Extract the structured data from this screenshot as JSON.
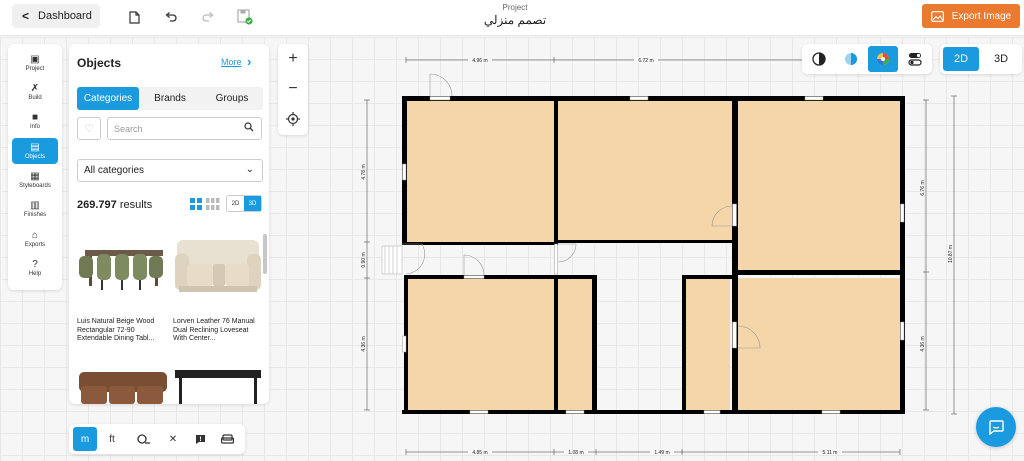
{
  "topbar": {
    "dashboard_label": "Dashboard",
    "project_label": "Project",
    "project_name": "تصمم منزلي",
    "export_label": "Export Image"
  },
  "rail": {
    "items": [
      {
        "label": "Project",
        "icon": "project-icon"
      },
      {
        "label": "Build",
        "icon": "build-icon"
      },
      {
        "label": "Info",
        "icon": "info-icon"
      },
      {
        "label": "Objects",
        "icon": "objects-icon"
      },
      {
        "label": "Styleboards",
        "icon": "styleboards-icon"
      },
      {
        "label": "Finishes",
        "icon": "finishes-icon"
      },
      {
        "label": "Exports",
        "icon": "exports-icon"
      },
      {
        "label": "Help",
        "icon": "help-icon"
      }
    ],
    "active": "Objects"
  },
  "objects_panel": {
    "title": "Objects",
    "more_label": "More",
    "tabs": [
      {
        "label": "Categories"
      },
      {
        "label": "Brands"
      },
      {
        "label": "Groups"
      }
    ],
    "active_tab": "Categories",
    "search_placeholder": "Search",
    "category_selected": "All categories",
    "results_count": "269.797",
    "results_label": "results",
    "dim_2d": "2D",
    "dim_3d": "3D",
    "active_dim": "3D",
    "products": [
      {
        "name": "Luis Natural Beige Wood Rectangular 72-90 Extendable Dining Tabl..."
      },
      {
        "name": "Lorven Leather 76 Manual Dual Reclining Loveseat With Center..."
      },
      {
        "name": ""
      },
      {
        "name": ""
      }
    ]
  },
  "bottombar": {
    "unit_m": "m",
    "unit_ft": "ft",
    "active_unit": "m"
  },
  "view_switch": {
    "label_2d": "2D",
    "label_3d": "3D",
    "active": "2D"
  },
  "floorplan": {
    "top_dims": [
      "4.96 m",
      "6.72 m"
    ],
    "bottom_dims": [
      "4.85 m",
      "1.08 m",
      "1.49 m",
      "5.11 m"
    ],
    "left_dims": [
      "4.78 m",
      "0.90 m",
      "4.36 m"
    ],
    "right_dims": [
      "6.76 m",
      "4.36 m"
    ],
    "overall_right_dim": "10.87 m",
    "floor_color": "#f5d6a9",
    "wall_color": "#000000"
  },
  "colors": {
    "accent": "#1a9be0",
    "export": "#ea7a2f"
  }
}
